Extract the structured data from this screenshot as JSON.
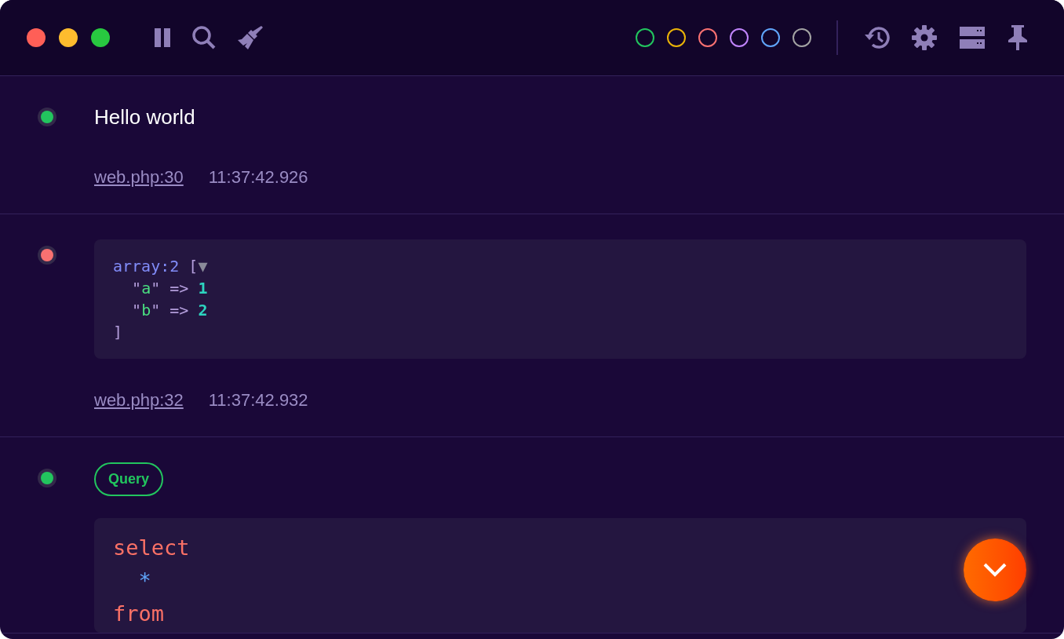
{
  "filters": [
    {
      "color": "#22c55e",
      "selected": false
    },
    {
      "color": "#eab308",
      "selected": false
    },
    {
      "color": "#f87171",
      "selected": false
    },
    {
      "color": "#c084fc",
      "selected": false
    },
    {
      "color": "#60a5fa",
      "selected": false
    },
    {
      "color": "#a3a3a3",
      "selected": false
    }
  ],
  "entries": [
    {
      "kind": "text",
      "color": "#22c55e",
      "text": "Hello world",
      "file": "web.php:30",
      "time": "11:37:42.926"
    },
    {
      "kind": "dump",
      "color": "#f87171",
      "lines": [
        [
          {
            "kind": "type",
            "text": "array:2"
          },
          {
            "kind": "punct",
            "text": " ["
          },
          {
            "kind": "toggle",
            "text": "▼"
          }
        ],
        [
          {
            "kind": "punct",
            "text": "  \""
          },
          {
            "kind": "key",
            "text": "a"
          },
          {
            "kind": "punct",
            "text": "\" => "
          },
          {
            "kind": "number",
            "text": "1"
          }
        ],
        [
          {
            "kind": "punct",
            "text": "  \""
          },
          {
            "kind": "key",
            "text": "b"
          },
          {
            "kind": "punct",
            "text": "\" => "
          },
          {
            "kind": "number",
            "text": "2"
          }
        ],
        [
          {
            "kind": "punct",
            "text": "]"
          }
        ]
      ],
      "file": "web.php:32",
      "time": "11:37:42.932"
    },
    {
      "kind": "query",
      "color": "#22c55e",
      "badge": "Query",
      "lines": [
        [
          {
            "kind": "keyword",
            "text": "select"
          }
        ],
        [
          {
            "kind": "operator",
            "text": "  *"
          }
        ],
        [
          {
            "kind": "keyword",
            "text": "from"
          }
        ]
      ]
    }
  ]
}
